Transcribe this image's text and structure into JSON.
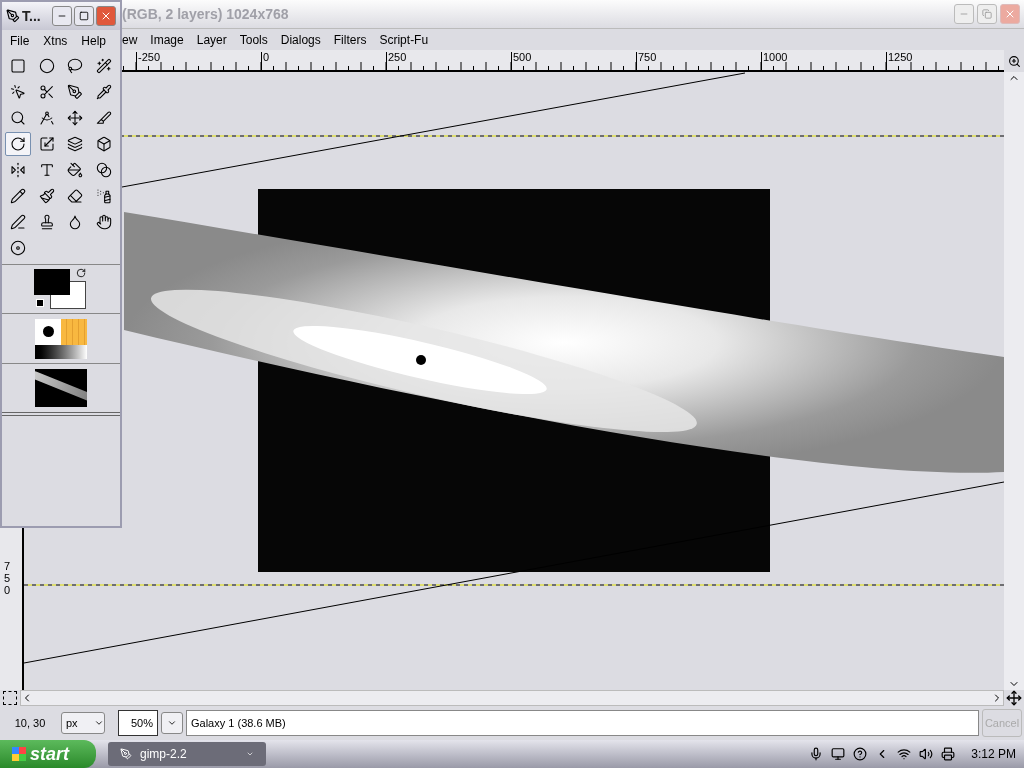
{
  "image_window": {
    "title": "(RGB, 2 layers) 1024x768",
    "menu": [
      "ew",
      "Image",
      "Layer",
      "Tools",
      "Dialogs",
      "Filters",
      "Script-Fu"
    ],
    "ruler_labels": [
      "-250",
      "0",
      "250",
      "500",
      "750",
      "1000",
      "1250"
    ],
    "vertical_ruler_label": "750",
    "status": {
      "coordinates": "10, 30",
      "unit": "px",
      "zoom": "50%",
      "message": "Galaxy 1 (38.6 MB)",
      "cancel": {
        "label": "Cancel",
        "disabled": true
      }
    }
  },
  "toolbox": {
    "title": "T...",
    "menu": [
      "File",
      "Xtns",
      "Help"
    ],
    "tools": [
      {
        "selected": false
      },
      {
        "selected": false
      },
      {
        "selected": false
      },
      {
        "selected": false
      },
      {
        "selected": false
      },
      {
        "selected": false
      },
      {
        "selected": false
      },
      {
        "selected": false
      },
      {
        "selected": false
      },
      {
        "selected": false
      },
      {
        "selected": false
      },
      {
        "selected": false
      },
      {
        "selected": true
      },
      {
        "selected": false
      },
      {
        "selected": false
      },
      {
        "selected": false
      },
      {
        "selected": false
      },
      {
        "selected": false
      },
      {
        "selected": false
      },
      {
        "selected": false
      },
      {
        "selected": false
      },
      {
        "selected": false
      },
      {
        "selected": false
      },
      {
        "selected": false
      },
      {
        "selected": false
      },
      {
        "selected": false
      },
      {
        "selected": false
      },
      {
        "selected": false
      },
      {
        "selected": false
      }
    ]
  },
  "taskbar": {
    "start": "start",
    "tasks": [
      {
        "label": "gimp-2.2",
        "selected": false
      }
    ],
    "clock": "3:12 PM"
  }
}
